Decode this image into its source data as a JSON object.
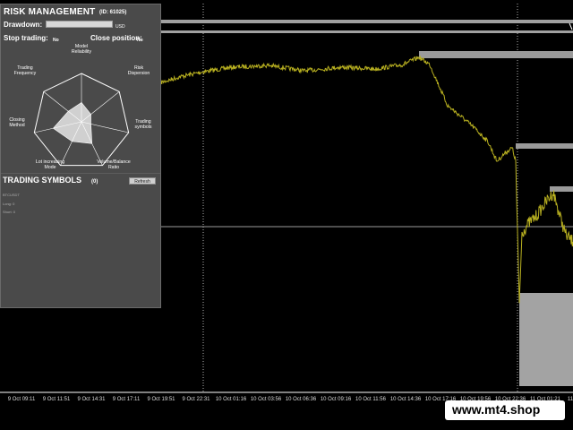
{
  "risk_panel": {
    "title": "RISK MANAGEMENT",
    "id_text": "(ID: 61025)",
    "drawdown_label": "Drawdown:",
    "drawdown_unit": "USD",
    "stop_trading_label": "Stop trading:",
    "stop_trading_value": "No",
    "close_position_label": "Close position:",
    "close_position_value": "No",
    "radar_axes": [
      [
        "Model",
        "Reliability"
      ],
      [
        "Risk",
        "Dispersion"
      ],
      [
        "Trading",
        "symbols"
      ],
      [
        "Volume/Balance",
        "Ratio"
      ],
      [
        "Lot increasing",
        "Mode"
      ],
      [
        "Closing",
        "Method"
      ],
      [
        "Trading",
        "Frequency"
      ]
    ],
    "radar_values": [
      0.4,
      0.25,
      0.2,
      0.5,
      0.45,
      0.6,
      0.35
    ]
  },
  "symbols_panel": {
    "title": "TRADING SYMBOLS",
    "count": "(0)",
    "refresh_label": "Refresh",
    "rows": [
      "BTCUSDT",
      "Long: 0",
      "Short: 0"
    ]
  },
  "time_axis": [
    "9 Oct 09:11",
    "9 Oct 11:51",
    "9 Oct 14:31",
    "9 Oct 17:11",
    "9 Oct 19:51",
    "9 Oct 22:31",
    "10 Oct 01:16",
    "10 Oct 03:56",
    "10 Oct 06:36",
    "10 Oct 09:16",
    "10 Oct 11:56",
    "10 Oct 14:36",
    "10 Oct 17:16",
    "10 Oct 19:56",
    "10 Oct 22:36",
    "11 Oct 01:21",
    "11"
  ],
  "watermark": "www.mt4.shop",
  "colors": {
    "price_line": "#b8b020",
    "panel_bg": "#4a4a4a",
    "bars": "#9a9a9a"
  }
}
